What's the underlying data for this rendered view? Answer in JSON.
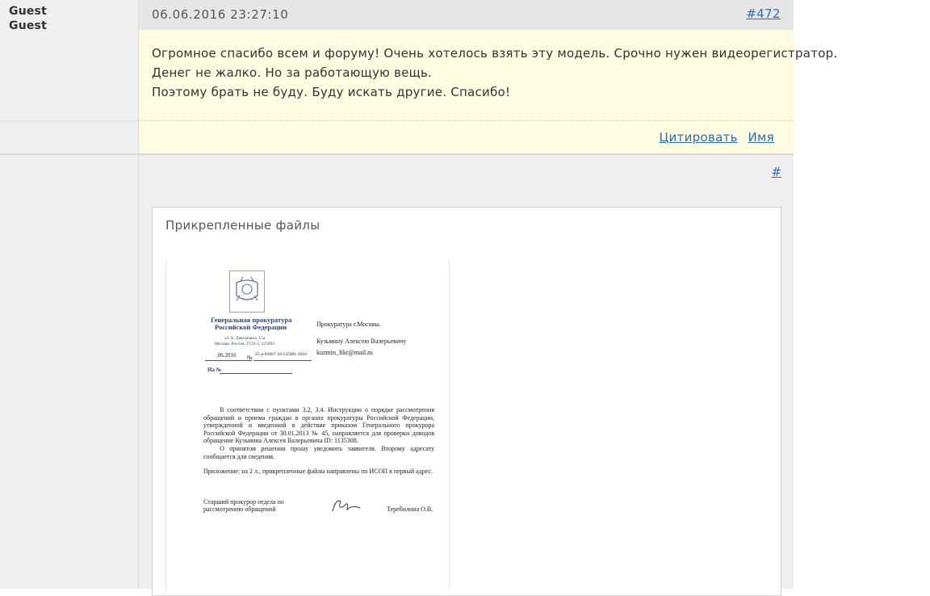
{
  "post1": {
    "user_name": "Guest",
    "user_title": "Guest",
    "date": "06.06.2016 23:27:10",
    "number": "#472",
    "lines": [
      "Огромное спасибо всем и форуму! Очень хотелось взять эту модель. Срочно нужен видеорегистратор.",
      "Денег не жалко. Но за работающую вещь.",
      "Поэтому брать не буду. Буду искать другие. Спасибо!"
    ],
    "quote_label": "Цитировать",
    "name_label": "Имя"
  },
  "post2": {
    "hash_label": "#",
    "attachments_title": "Прикрепленные файлы"
  },
  "document": {
    "org_line1": "Генеральная прокуратура",
    "org_line2": "Российской Федерации",
    "address1": "ул. Б. Дмитровка, 15а",
    "address2": "Москва, Россия, ГСП-3, 125993",
    "date": ".06.2016",
    "number_prefix": "№",
    "reg_number": "25-р-83067-16/125981-2016",
    "to_ref": "На №",
    "recipient1": "Прокуратура г.Москвы.",
    "recipient2": "Кузьмину Алексею Валерьевичу",
    "recipient3": "kuzmin_fikr@mail.ru",
    "body": "В соответствии с пунктами 3.2, 3.4. Инструкции о порядке рассмотрения обращений и приема граждан в органах прокуратуры Российской Федерации, утвержденной и введенной в действие приказом Генерального прокурора Российской Федерации от 30.01.2013 № 45, направляется для проверки доводов обращение Кузьмина Алексея Валерьевича ID: 1135308.",
    "body2": "О принятом решении прошу уведомить заявителя. Второму адресату сообщается для сведения.",
    "appendix": "Приложение: на 2 л., прикрепленные файлы направлены по ИСОП в первый адрес.",
    "signer_title1": "Старший прокурор отдела по",
    "signer_title2": "рассмотрению обращений",
    "signer_name": "Теребилина О.В."
  }
}
